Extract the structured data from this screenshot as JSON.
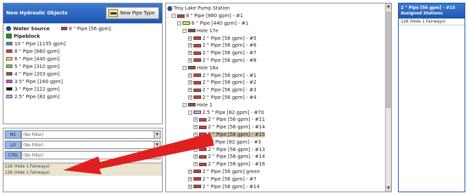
{
  "objects_panel": {
    "title": "New Hydraulic Objects",
    "new_pipe_button": "New Pipe Type",
    "water_source": {
      "label": "Water Source",
      "pipe": "8 \" Pipe [56 gpm]",
      "pipe_color": "#c0392b"
    },
    "pipeblock": {
      "label": "Pipeblock"
    },
    "items": [
      {
        "label": "10 \" Pipe [1155 gpm]",
        "color": "#3d8fd6"
      },
      {
        "label": "8 \" Pipe [660 gpm]",
        "color": "#d23a3a"
      },
      {
        "label": "6 \" Pipe [440 gpm]",
        "color": "#e6e632"
      },
      {
        "label": "5 \" Pipe [310 gpm]",
        "color": "#6fcf4a"
      },
      {
        "label": "4 \" Pipe [203 gpm]",
        "color": "#8b5a2b"
      },
      {
        "label": "3.5\" Pipe [160 gpm]",
        "color": "#d14ad1"
      },
      {
        "label": "3 \" Pipe [122 gpm]",
        "color": "#111111"
      },
      {
        "label": "2.5\" Pipe [82 gpm]",
        "color": "#c9a6e0"
      }
    ]
  },
  "filters": [
    {
      "label": "M1",
      "value": "(No Filter)"
    },
    {
      "label": "LO",
      "value": "(No Filter)"
    },
    {
      "label": "CTRL",
      "value": "(No Filter)"
    }
  ],
  "filter_results": [
    "126 (Hole 1 Fairways)",
    "126 (Hole 1 Fairways)"
  ],
  "tree": {
    "nodes": [
      {
        "text": "Troy Lake Pump Station",
        "color": "",
        "pm": "",
        "icon": "station"
      },
      {
        "text": "8 \" Pipe [880 gpm] - #1",
        "color": "#d23a3a",
        "pm": "-"
      },
      {
        "text": "6 \" Pipe [440 gpm] - #1",
        "color": "#e6e632",
        "pm": "-"
      },
      {
        "text": "Hole 17e",
        "color": "#8b5a2b",
        "pm": "-"
      },
      {
        "text": "2 \" Pipe [56 gpm] - #5",
        "color": "#d23a3a",
        "pm": "+"
      },
      {
        "text": "2 \" Pipe [56 gpm] - #6",
        "color": "#d23a3a",
        "pm": "+"
      },
      {
        "text": "2 \" Pipe [56 gpm] - #7",
        "color": "#d23a3a",
        "pm": "+"
      },
      {
        "text": "2 \" Pipe [56 gpm] - #8",
        "color": "#d23a3a",
        "pm": "+"
      },
      {
        "text": "Hole 16a",
        "color": "#8b5a2b",
        "pm": "-"
      },
      {
        "text": "2 \" Pipe [56 gpm] - #1",
        "color": "#d23a3a",
        "pm": "+"
      },
      {
        "text": "2 \" Pipe [56 gpm] - #2",
        "color": "#d23a3a",
        "pm": "+"
      },
      {
        "text": "2 \" Pipe [56 gpm] - #3",
        "color": "#d23a3a",
        "pm": "+"
      },
      {
        "text": "2 \" Pipe [56 gpm] - #4",
        "color": "#d23a3a",
        "pm": "+"
      },
      {
        "text": "Hole 1",
        "color": "#8b5a2b",
        "pm": "-"
      },
      {
        "text": "2.5 \" Pipe [82 gpm] - #70",
        "color": "#c9a6e0",
        "pm": "-"
      },
      {
        "text": "2 \" Pipe [56 gpm] - #11",
        "color": "#d23a3a",
        "pm": "+"
      },
      {
        "text": "2 \" Pipe [56 gpm] - #14",
        "color": "#d23a3a",
        "pm": "+"
      },
      {
        "text": "2 \" Pipe [56 gpm] - #15",
        "color": "#d23a3a",
        "pm": "+",
        "state": "sel"
      },
      {
        "text": "2.5 \" Pipe [82 gpm] - #3",
        "color": "#c9a6e0",
        "pm": "-"
      },
      {
        "text": "2 \" Pipe [56 gpm] - #13",
        "color": "#d23a3a",
        "pm": "+"
      },
      {
        "text": "2 \" Pipe [56 gpm] - #14",
        "color": "#d23a3a",
        "pm": "+"
      },
      {
        "text": "2 \" Pipe [56 gpm] - #16",
        "color": "#d23a3a",
        "pm": "+"
      },
      {
        "text": "2 \" Pipe [56 gpm] green",
        "color": "#d23a3a",
        "pm": "+"
      },
      {
        "text": "2 \" Pipe [56 gpm] - #7",
        "color": "#d23a3a",
        "pm": "+"
      },
      {
        "text": "2 \" Pipe [56 gpm] - #14",
        "color": "#d23a3a",
        "pm": "+"
      }
    ]
  },
  "assigned_panel": {
    "title": "2 \" Pipe [56 gpm] - #15 Assigned Stations",
    "items": [
      "126 (Hole 1 Fairways)"
    ]
  },
  "annotation": {
    "arrow_color": "#e02020"
  }
}
